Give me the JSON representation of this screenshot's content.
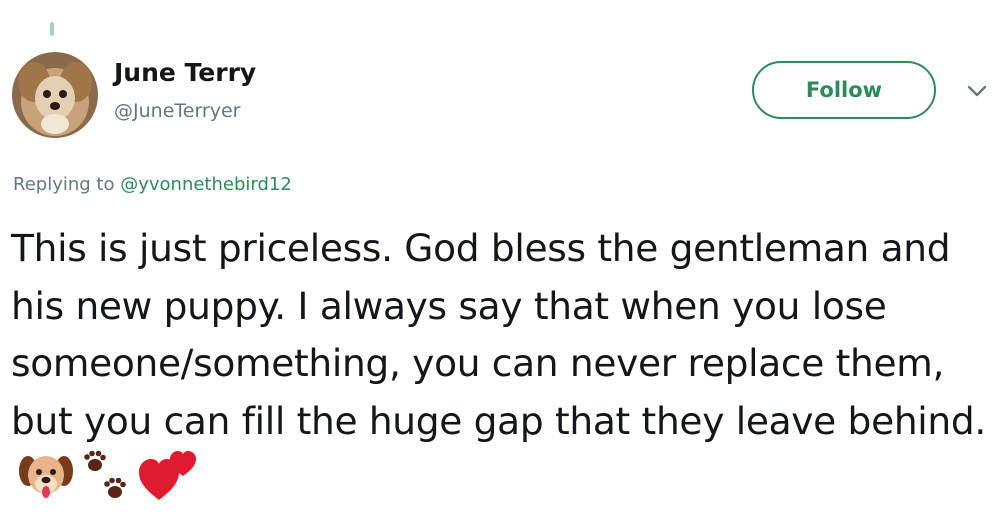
{
  "tweet": {
    "author_name": "June Terry",
    "author_handle": "@JuneTerryer",
    "follow_label": "Follow",
    "replying_prefix": "Replying to",
    "replying_to": "@yvonnethebird12",
    "text": "This is just priceless. God bless the gentleman and his new puppy. I always say that when you lose someone/something, you can never replace them, but you can fill the huge gap that they leave behind.",
    "emojis": [
      "dog-face-icon",
      "paw-prints-icon",
      "two-hearts-icon"
    ]
  },
  "colors": {
    "accent": "#2e8b57",
    "text": "#14171a",
    "muted": "#657786"
  }
}
